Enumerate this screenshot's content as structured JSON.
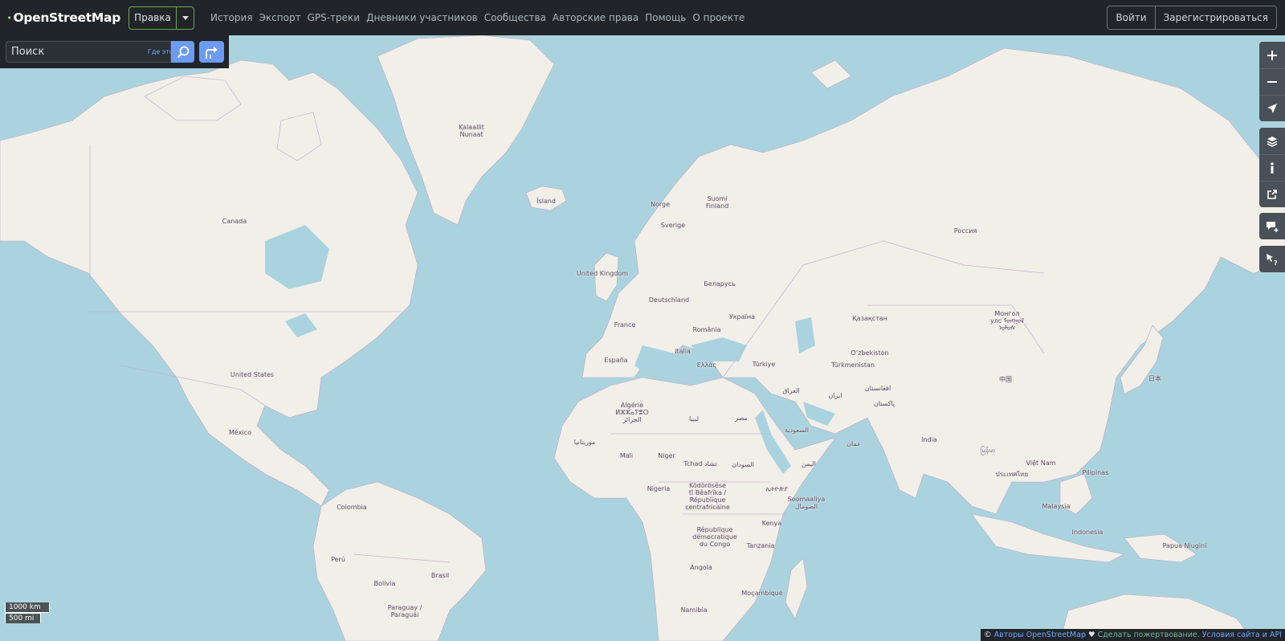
{
  "header": {
    "logo_text": "OpenStreetMap",
    "edit_label": "Правка",
    "nav": [
      "История",
      "Экспорт",
      "GPS-треки",
      "Дневники участников",
      "Сообщества",
      "Авторские права",
      "Помощь",
      "О проекте"
    ],
    "login_label": "Войти",
    "signup_label": "Зарегистрироваться"
  },
  "search": {
    "placeholder": "Поиск",
    "where_label": "Где это?"
  },
  "scale": {
    "km": "1000 km",
    "mi": "500 mi"
  },
  "attribution": {
    "copyright": "©",
    "authors": "Авторы OpenStreetMap",
    "arrow": "♥",
    "donate": "Сделать пожертвование.",
    "terms": "Условия сайта и API"
  },
  "map_labels": {
    "kalaallit": "Kalaallit\nNunaat",
    "island": "Ísland",
    "canada": "Canada",
    "norge": "Norge",
    "suomi": "Suomi\nFinland",
    "sverige": "Sverige",
    "rossiya": "Россия",
    "uk": "United Kingdom",
    "belarus": "Беларусь",
    "deutschland": "Deutschland",
    "ukraina": "Україна",
    "france": "France",
    "romania": "România",
    "kazakhstan": "Қазақстан",
    "mongol": "Монгол\nулс ᠮᠣᠩᠭᠣᠯ\nᠤᠯᠤᠰ",
    "italia": "Italia",
    "ozbekiston": "O‘zbekiston",
    "espana": "España",
    "ellas": "Ελλάς",
    "turkiye": "Türkiye",
    "turkmenistan": "Türkmenistan",
    "usa": "United States",
    "iraq": "العراق",
    "iran": "ایران",
    "afghanistan": "افغانستان",
    "pakistan": "پاکستان",
    "china": "中国",
    "japan": "日本",
    "algerie": "Algérie\nⵍⵣⵣⴰⵢⴻⵔ\nالجزائر",
    "libya": "ليبيا",
    "misr": "مصر",
    "saudi": "السعودية",
    "oman": "عمان",
    "mexico": "México",
    "mauritania": "موريتانيا",
    "india": "India",
    "myanmar": "မြန်မာ",
    "mali": "Mali",
    "niger": "Niger",
    "tchad": "Tchad تشاد",
    "sudan": "السودان",
    "yemen": "اليمن",
    "vietnam": "Việt Nam",
    "thailand": "ประเทศไทย",
    "pilipinas": "Pilipinas",
    "nigeria": "Nigeria",
    "kodorose": "Ködörösêse\ntî Bêafrîka /\nRépublique\ncentrafricaine",
    "ethiopia": "ኢትዮጵያ",
    "somalia": "Soomaaliya\nالصومال",
    "colombia": "Colombia",
    "malaysia": "Malaysia",
    "rdc": "République\ndémocratique\ndu Congo",
    "kenya": "Kenya",
    "indonesia": "Indonesia",
    "tanzania": "Tanzania",
    "papua": "Papua Niugini",
    "peru": "Perú",
    "brasil": "Brasil",
    "angola": "Angola",
    "mocambique": "Moçambique",
    "bolivia": "Bolivia",
    "namibia": "Namibia",
    "paraguay": "Paraguay /\nParaguái"
  }
}
